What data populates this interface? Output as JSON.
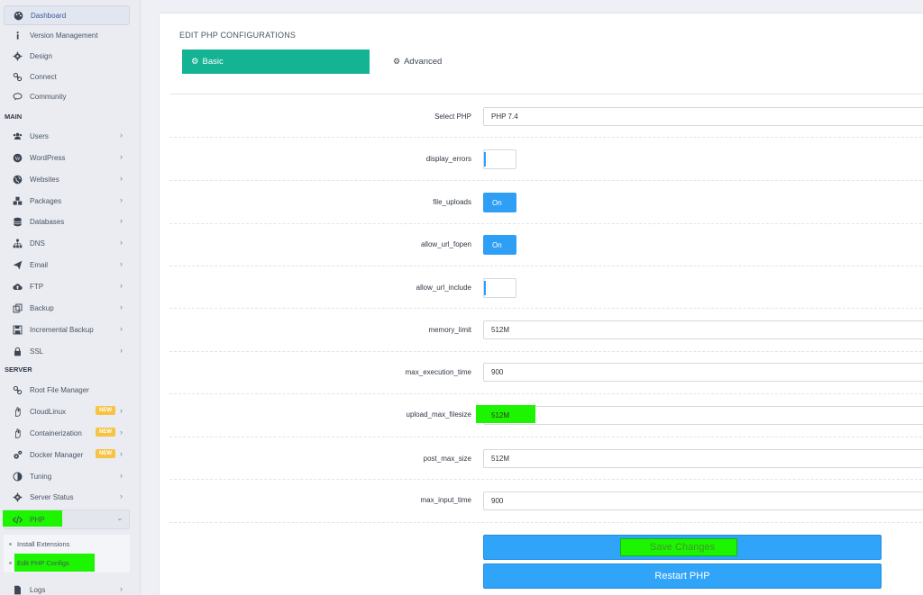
{
  "sidebar": {
    "items_top": [
      {
        "label": "Dashboard",
        "icon": "palette-icon"
      },
      {
        "label": "Version Management",
        "icon": "info-icon"
      },
      {
        "label": "Design",
        "icon": "gear-icon"
      },
      {
        "label": "Connect",
        "icon": "link-icon"
      },
      {
        "label": "Community",
        "icon": "chat-icon"
      }
    ],
    "main_section": "MAIN",
    "items_main": [
      {
        "label": "Users",
        "icon": "users-icon"
      },
      {
        "label": "WordPress",
        "icon": "wordpress-icon"
      },
      {
        "label": "Websites",
        "icon": "globe-icon"
      },
      {
        "label": "Packages",
        "icon": "cubes-icon"
      },
      {
        "label": "Databases",
        "icon": "database-icon"
      },
      {
        "label": "DNS",
        "icon": "sitemap-icon"
      },
      {
        "label": "Email",
        "icon": "paper-plane-icon"
      },
      {
        "label": "FTP",
        "icon": "cloud-upload-icon"
      },
      {
        "label": "Backup",
        "icon": "copy-icon"
      },
      {
        "label": "Incremental Backup",
        "icon": "save-icon"
      },
      {
        "label": "SSL",
        "icon": "lock-icon"
      }
    ],
    "server_section": "SERVER",
    "items_server": [
      {
        "label": "Root File Manager",
        "icon": "link-icon"
      },
      {
        "label": "CloudLinux",
        "icon": "hand-icon",
        "badge": "NEW"
      },
      {
        "label": "Containerization",
        "icon": "hand-icon",
        "badge": "NEW"
      },
      {
        "label": "Docker Manager",
        "icon": "cogs-icon",
        "badge": "NEW"
      },
      {
        "label": "Tuning",
        "icon": "adjust-icon"
      },
      {
        "label": "Server Status",
        "icon": "gear-icon"
      }
    ],
    "php": {
      "label": "PHP",
      "icon": "code-icon"
    },
    "php_sub": [
      "Install Extensions",
      "Edit PHP Configs"
    ],
    "logs": {
      "label": "Logs",
      "icon": "file-icon"
    }
  },
  "card": {
    "title": "EDIT PHP CONFIGURATIONS",
    "tab_basic": "Basic",
    "tab_advanced": "Advanced"
  },
  "form": {
    "select_php": {
      "label": "Select PHP",
      "value": "PHP 7.4"
    },
    "display_errors": {
      "label": "display_errors",
      "state": "off"
    },
    "file_uploads": {
      "label": "file_uploads",
      "state": "On"
    },
    "allow_url_fopen": {
      "label": "allow_url_fopen",
      "state": "On"
    },
    "allow_url_include": {
      "label": "allow_url_include",
      "state": "off"
    },
    "memory_limit": {
      "label": "memory_limit",
      "value": "512M"
    },
    "max_execution_time": {
      "label": "max_execution_time",
      "value": "900"
    },
    "upload_max_filesize": {
      "label": "upload_max_filesize",
      "value": "512M"
    },
    "post_max_size": {
      "label": "post_max_size",
      "value": "512M"
    },
    "max_input_time": {
      "label": "max_input_time",
      "value": "900"
    }
  },
  "buttons": {
    "save": "Save Changes",
    "restart": "Restart PHP"
  },
  "colors": {
    "accent_teal": "#13b394",
    "button_blue": "#2fa4f8",
    "highlight_green": "#1df400",
    "badge_yellow": "#f6c343"
  }
}
